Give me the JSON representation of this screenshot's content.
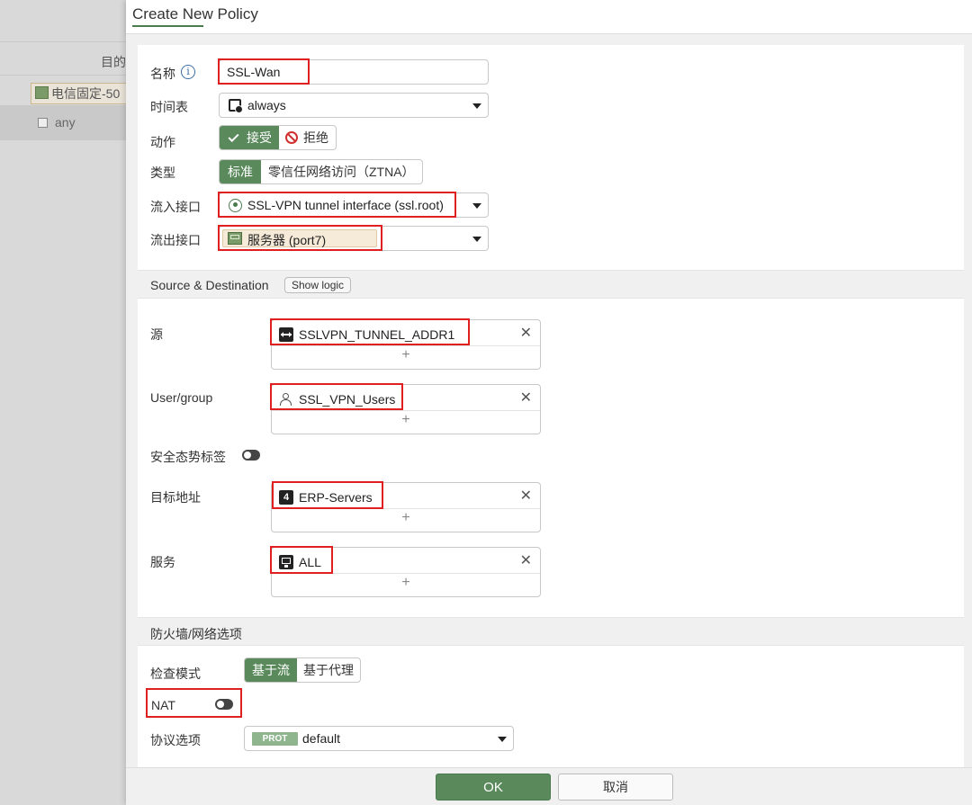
{
  "background": {
    "column_header": "目的",
    "row_tag": "电信固定-50",
    "row_any": "any"
  },
  "dialog": {
    "title": "Create New Policy"
  },
  "form": {
    "name": {
      "label": "名称",
      "value": "SSL-Wan",
      "info_icon": "info-icon"
    },
    "schedule": {
      "label": "时间表",
      "value": "always",
      "icon": "schedule-clock-icon"
    },
    "action": {
      "label": "动作",
      "accept": "接受",
      "deny": "拒绝",
      "selected": "接受"
    },
    "type": {
      "label": "类型",
      "standard": "标准",
      "ztna": "零信任网络访问（ZTNA）",
      "selected": "标准"
    },
    "incoming": {
      "label": "流入接口",
      "value": "SSL-VPN tunnel interface (ssl.root)",
      "icon": "ssl-tunnel-icon"
    },
    "outgoing": {
      "label": "流出接口",
      "value": "服务器 (port7)",
      "icon": "port-icon"
    },
    "source_dest_section": {
      "title": "Source & Destination",
      "show_logic": "Show logic"
    },
    "source": {
      "label": "源",
      "value": "SSLVPN_TUNNEL_ADDR1",
      "icon": "address-range-icon"
    },
    "user_group": {
      "label": "User/group",
      "value": "SSL_VPN_Users",
      "icon": "user-group-icon"
    },
    "security_posture": {
      "label": "安全态势标签",
      "enabled": false
    },
    "destination": {
      "label": "目标地址",
      "value": "ERP-Servers",
      "icon": "ipv4-address-icon"
    },
    "service": {
      "label": "服务",
      "value": "ALL",
      "icon": "service-icon"
    },
    "firewall_section": {
      "title": "防火墙/网络选项"
    },
    "inspection_mode": {
      "label": "检查模式",
      "flow": "基于流",
      "proxy": "基于代理",
      "selected": "基于流"
    },
    "nat": {
      "label": "NAT",
      "enabled": false
    },
    "protocol_options": {
      "label": "协议选项",
      "badge": "PROT",
      "value": "default"
    }
  },
  "footer": {
    "ok": "OK",
    "cancel": "取消"
  },
  "colors": {
    "accent_green": "#5a8a5c",
    "highlight_red": "#e02020"
  }
}
